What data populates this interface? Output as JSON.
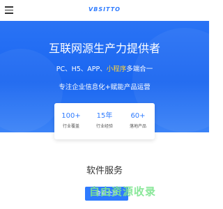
{
  "header": {
    "logo_text": "VBSITTO"
  },
  "hero": {
    "title": "互联网源生产力提供者",
    "sub_prefix": "PC、H5、APP、",
    "sub_highlight": "小程序",
    "sub_suffix": "多端合一",
    "slogan": "专注企业信息化+赋能产品运营"
  },
  "stats": [
    {
      "number": "100+",
      "label": "行业覆盖"
    },
    {
      "number": "15年",
      "label": "行业经验"
    },
    {
      "number": "60+",
      "label": "落地产品"
    }
  ],
  "section": {
    "title": "软件服务"
  },
  "bottom_button": {
    "label": "查看全部"
  },
  "watermark": {
    "text": "自由资源收录"
  },
  "colors": {
    "accent": "#2e7bff",
    "hero_bg": "#1a66f0",
    "highlight": "#ffd23a"
  }
}
